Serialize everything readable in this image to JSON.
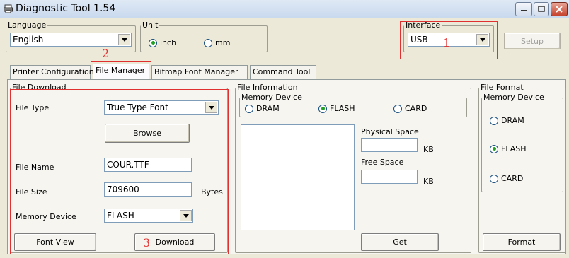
{
  "window": {
    "title": "Diagnostic Tool 1.54",
    "minimize_icon": "minimize-icon",
    "maximize_icon": "maximize-icon",
    "close_icon": "close-icon"
  },
  "top": {
    "language_legend": "Language",
    "language_value": "English",
    "unit_legend": "Unit",
    "unit_inch": "inch",
    "unit_mm": "mm",
    "unit_selected": "inch",
    "interface_legend": "Interface",
    "interface_value": "USB",
    "setup_label": "Setup"
  },
  "tabs": [
    {
      "label": "Printer Configuration"
    },
    {
      "label": "File Manager"
    },
    {
      "label": "Bitmap Font Manager"
    },
    {
      "label": "Command Tool"
    }
  ],
  "file_download": {
    "legend": "File Download",
    "file_type_label": "File Type",
    "file_type_value": "True Type Font",
    "browse_label": "Browse",
    "file_name_label": "File Name",
    "file_name_value": "COUR.TTF",
    "file_size_label": "File Size",
    "file_size_value": "709600",
    "file_size_unit": "Bytes",
    "memory_device_label": "Memory Device",
    "memory_device_value": "FLASH",
    "font_view_label": "Font View",
    "download_label": "Download"
  },
  "file_information": {
    "legend": "File Information",
    "memory_legend": "Memory Device",
    "dram": "DRAM",
    "flash": "FLASH",
    "card": "CARD",
    "selected": "FLASH",
    "physical_space_label": "Physical Space",
    "physical_unit": "KB",
    "free_space_label": "Free Space",
    "free_unit": "KB",
    "get_label": "Get"
  },
  "file_format": {
    "legend": "File Format",
    "memory_legend": "Memory Device",
    "dram": "DRAM",
    "flash": "FLASH",
    "card": "CARD",
    "selected": "FLASH",
    "format_label": "Format"
  },
  "annotations": {
    "n1": "1",
    "n2": "2",
    "n3": "3"
  },
  "colors": {
    "annotation_red": "#e03030",
    "window_bg": "#ece9d8"
  }
}
